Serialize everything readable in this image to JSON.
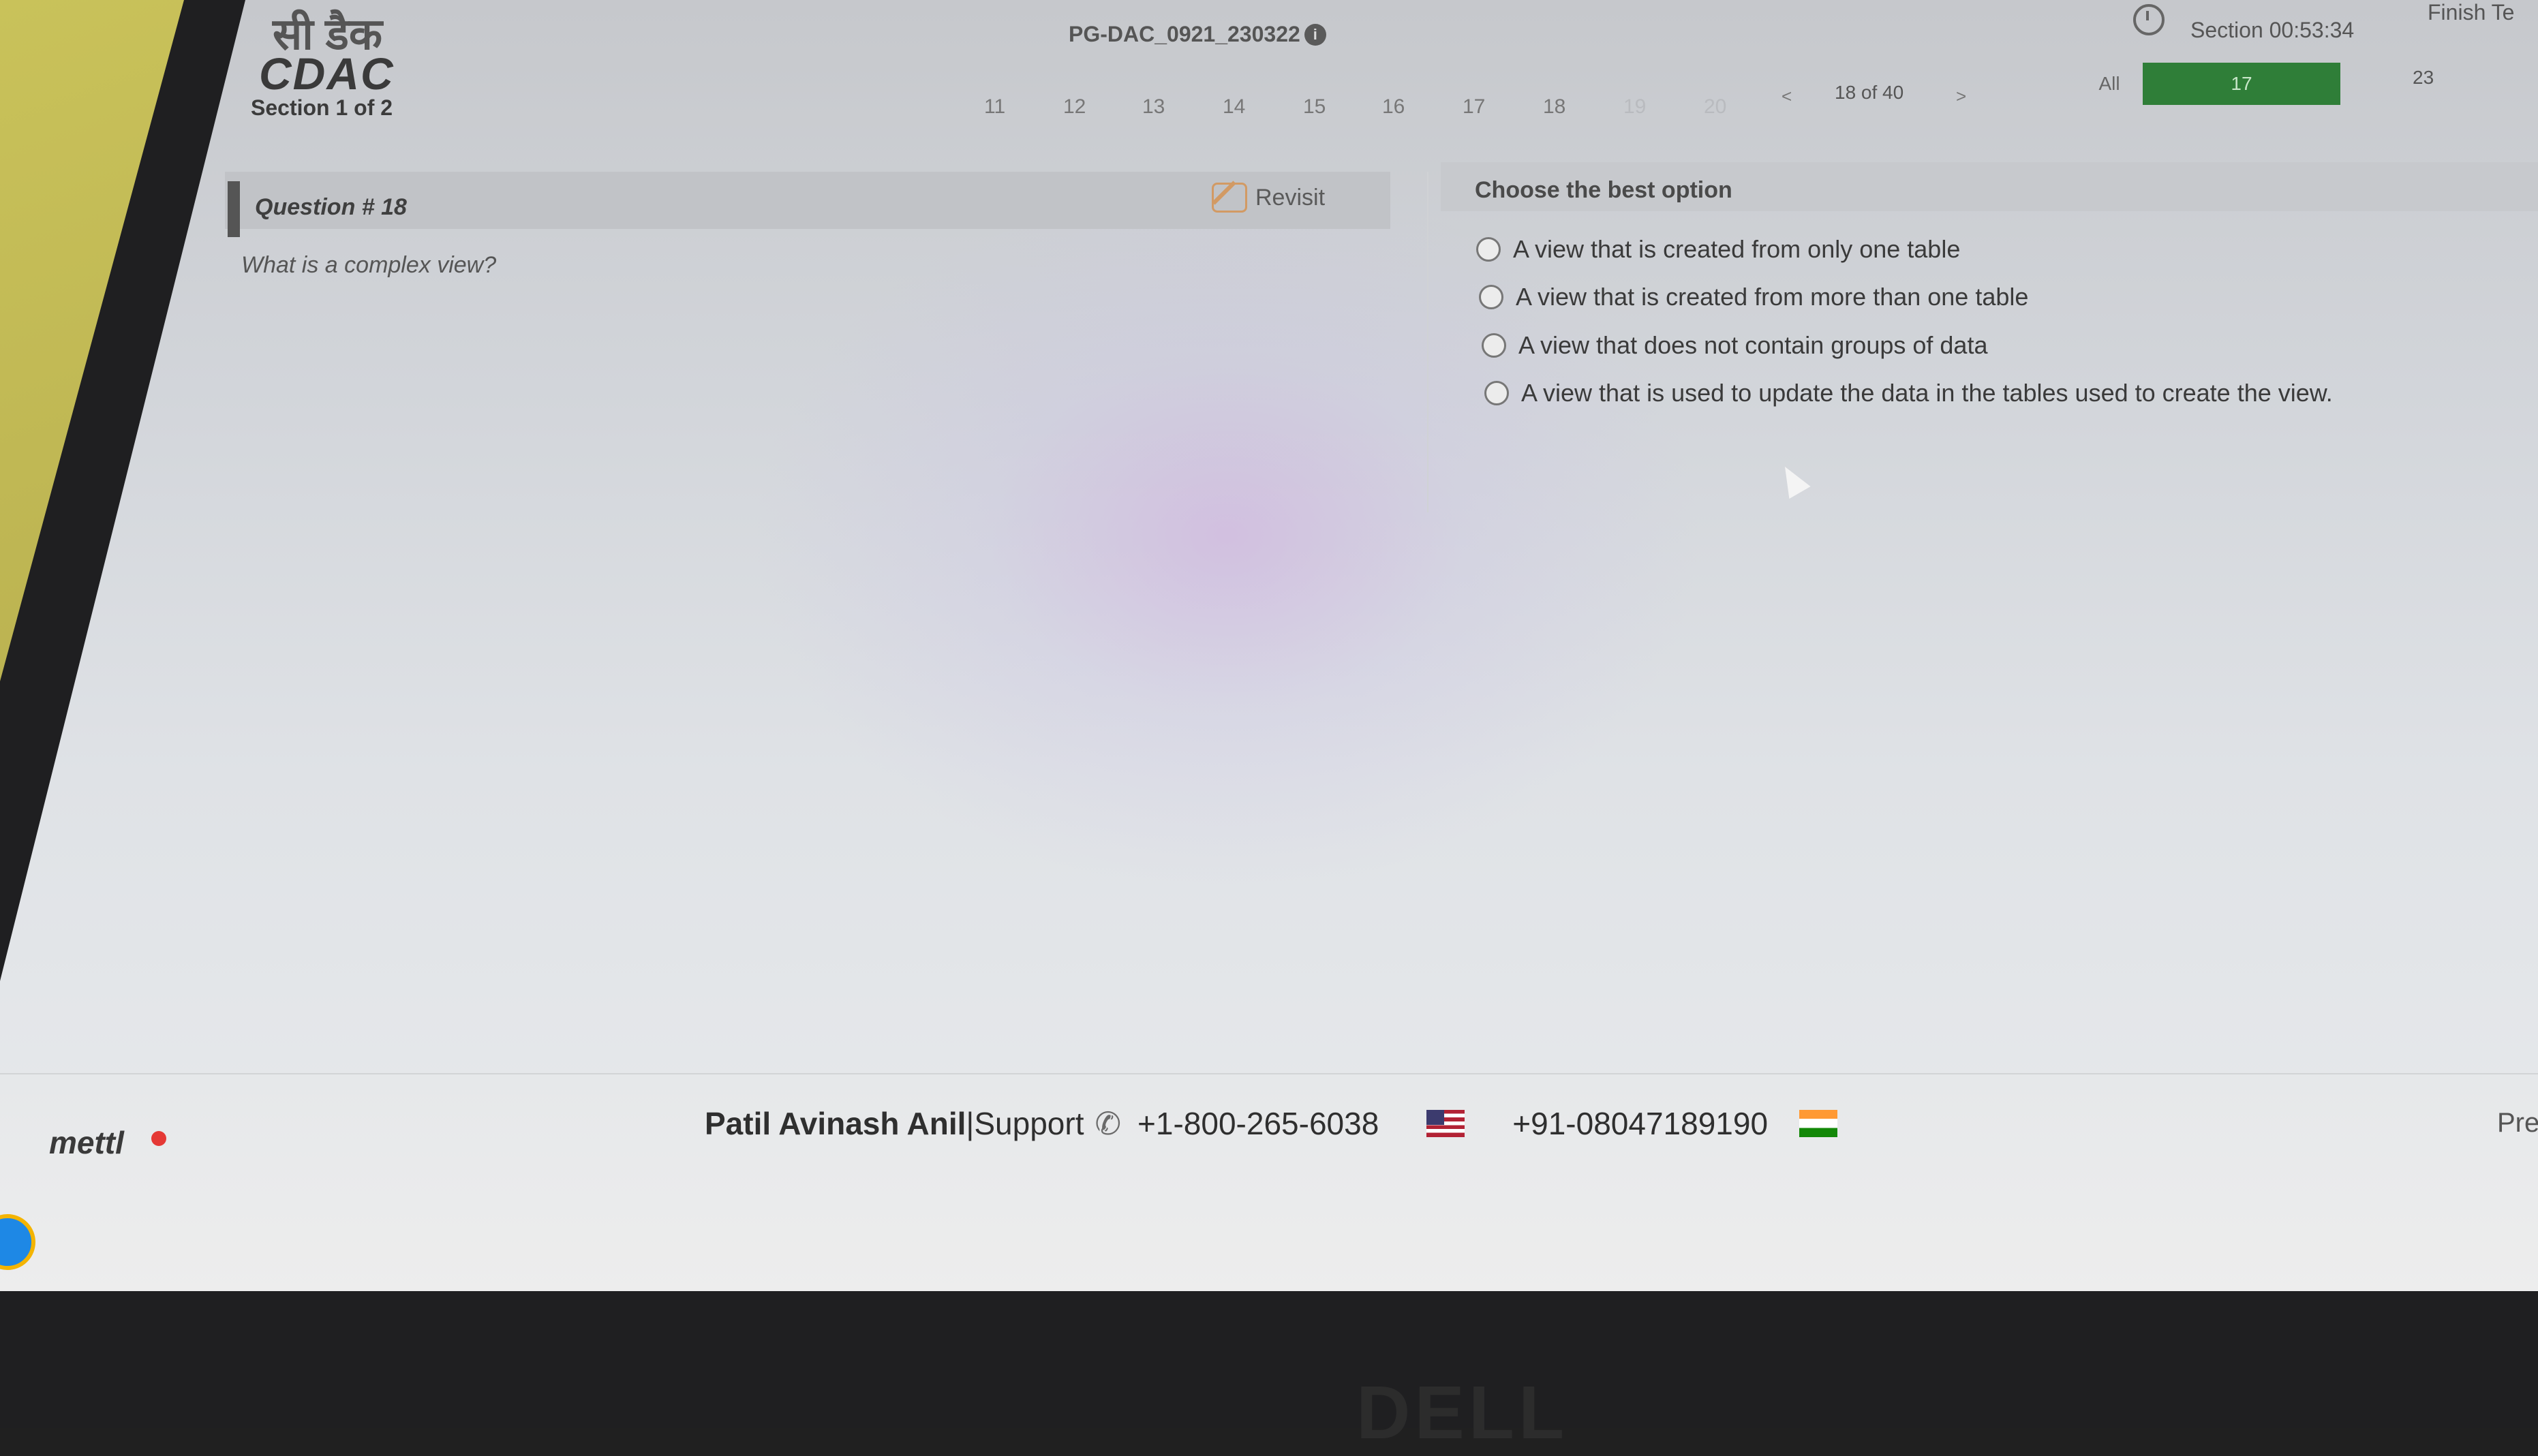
{
  "header": {
    "logo_hindi": "सी डैक",
    "logo_english": "CDAC",
    "section_label": "Section 1 of 2",
    "exam_code": "PG-DAC_0921_230322",
    "question_numbers": [
      "11",
      "12",
      "13",
      "14",
      "15",
      "16",
      "17",
      "18",
      "19",
      "20"
    ],
    "pager_prev": "<",
    "pager_count": "18 of 40",
    "pager_next": ">",
    "filter_all": "All",
    "filter_attempted": "17",
    "filter_other": "23",
    "timer": "Section 00:53:34",
    "finish_label": "Finish Te"
  },
  "question": {
    "title": "Question # 18",
    "revisit_label": "Revisit",
    "text": "What is a complex view?"
  },
  "options": {
    "header": "Choose the best option",
    "items": [
      "A view that is created from only one table",
      "A view that is created from more than one table",
      "A view that does not contain groups of data",
      "A view that is used to update the data in the tables used to create the view."
    ]
  },
  "footer": {
    "brand": "mettl",
    "candidate": "Patil Avinash Anil",
    "separator": " | ",
    "support_label": "Support",
    "phone_us": "+1-800-265-6038",
    "phone_in": "+91-08047189190",
    "prev_label": "Pre"
  },
  "bezel": {
    "brand": "DELL"
  },
  "colors": {
    "accent_green": "#2f7e38"
  }
}
